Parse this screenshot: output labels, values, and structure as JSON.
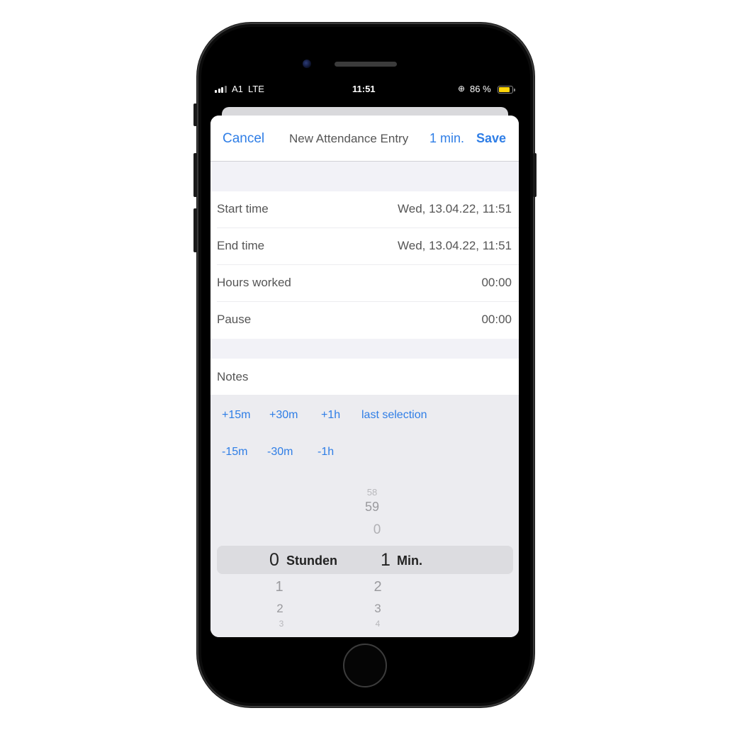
{
  "status_bar": {
    "carrier": "A1",
    "network": "LTE",
    "time": "11:51",
    "battery_percent": "86 %",
    "battery_level": 0.86,
    "lock_rotation_icon": "orientation-lock-icon"
  },
  "nav": {
    "cancel": "Cancel",
    "title": "New Attendance Entry",
    "duration": "1 min.",
    "save": "Save"
  },
  "rows": [
    {
      "label": "Start time",
      "value": "Wed, 13.04.22, 11:51"
    },
    {
      "label": "End time",
      "value": "Wed, 13.04.22, 11:51"
    },
    {
      "label": "Hours worked",
      "value": "00:00"
    },
    {
      "label": "Pause",
      "value": "00:00"
    }
  ],
  "notes": {
    "label": "Notes"
  },
  "quick_add": [
    "+15m",
    "+30m",
    "+1h",
    "last selection"
  ],
  "quick_sub": [
    "-15m",
    "-30m",
    "-1h"
  ],
  "picker": {
    "hours": {
      "above": [],
      "selected": "0",
      "below": [
        "1",
        "2",
        "3"
      ],
      "unit": "Stunden"
    },
    "minutes": {
      "above": [
        "58",
        "59",
        "0"
      ],
      "selected": "1",
      "below": [
        "2",
        "3",
        "4"
      ],
      "unit": "Min."
    }
  },
  "colors": {
    "accent": "#2f7ee6",
    "battery": "#ffd60a"
  }
}
